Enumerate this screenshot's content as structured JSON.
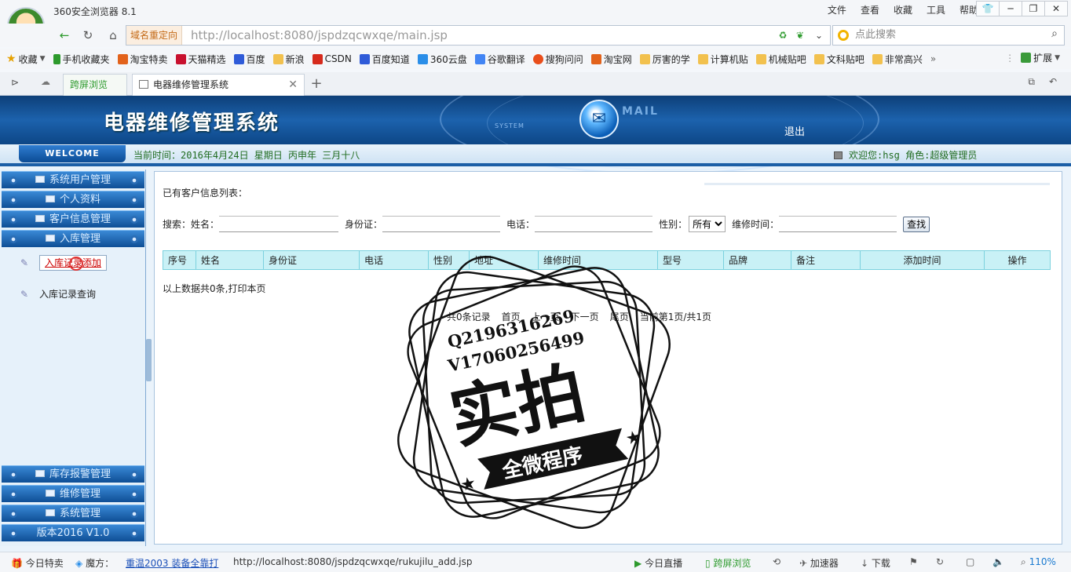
{
  "browser": {
    "app_title": "360安全浏览器 8.1",
    "menu": [
      "文件",
      "查看",
      "收藏",
      "工具",
      "帮助"
    ],
    "redirect_label": "域名重定向",
    "url": "http://localhost:8080/jspdzqcwxqe/main.jsp",
    "search_placeholder": "点此搜索",
    "bookmarks": [
      {
        "label": "收藏",
        "color": "#e6a100"
      },
      {
        "label": "手机收藏夹",
        "color": "#2d9a2d"
      },
      {
        "label": "淘宝特卖",
        "color": "#e2621b"
      },
      {
        "label": "天猫精选",
        "color": "#c8102e"
      },
      {
        "label": "百度",
        "color": "#2f5bd8"
      },
      {
        "label": "新浪",
        "color": "#f2c14e"
      },
      {
        "label": "CSDN",
        "color": "#d62a1c"
      },
      {
        "label": "百度知道",
        "color": "#2f5bd8"
      },
      {
        "label": "360云盘",
        "color": "#2a8ee8"
      },
      {
        "label": "谷歌翻译",
        "color": "#4285f4"
      },
      {
        "label": "搜狗问问",
        "color": "#e94e1b"
      },
      {
        "label": "淘宝网",
        "color": "#e2621b"
      },
      {
        "label": "厉害的学",
        "color": "#f2c14e"
      },
      {
        "label": "计算机贴",
        "color": "#f2c14e"
      },
      {
        "label": "机械贴吧",
        "color": "#f2c14e"
      },
      {
        "label": "文科贴吧",
        "color": "#f2c14e"
      },
      {
        "label": "非常高兴",
        "color": "#f2c14e"
      }
    ],
    "extensions_label": "扩展",
    "tabs": {
      "split_view": "跨屏浏览",
      "active": "电器维修管理系统"
    }
  },
  "header": {
    "system_title": "电器维修管理系统",
    "mail_text": "MAIL",
    "system_text": "SYSTEM",
    "logout": "退出",
    "welcome": "WELCOME",
    "current_time": "当前时间：2016年4月24日 星期日 丙申年 三月十八",
    "user_info": "欢迎您:hsg 角色:超级管理员"
  },
  "sidebar": {
    "menus_top": [
      "系统用户管理",
      "个人资料",
      "客户信息管理",
      "入库管理"
    ],
    "sub_items": [
      "入库记录添加",
      "入库记录查询"
    ],
    "menus_bottom": [
      "库存报警管理",
      "维修管理",
      "系统管理"
    ],
    "version": "版本2016 V1.0"
  },
  "main": {
    "list_title": "已有客户信息列表：",
    "search": {
      "label": "搜索：",
      "name_label": "姓名：",
      "id_label": "身份证：",
      "phone_label": "电话：",
      "gender_label": "性别：",
      "gender_value": "所有",
      "repair_time_label": "维修时间：",
      "button": "查找"
    },
    "columns": [
      "序号",
      "姓名",
      "身份证",
      "电话",
      "性别",
      "地址",
      "维修时间",
      "型号",
      "品牌",
      "备注",
      "添加时间",
      "操作"
    ],
    "summary": "以上数据共0条,打印本页",
    "pager": [
      "共0条记录",
      "首页",
      "上一页",
      "下一页",
      "尾页",
      "当前第1页/共1页"
    ]
  },
  "watermark": {
    "line1": "Q2196316269",
    "line2": "V17060256499",
    "big": "实拍",
    "ribbon": "全微程序"
  },
  "statusbar": {
    "today_deals": "今日特卖",
    "magic": "魔方：",
    "promo": "重温2003 装备全靠打",
    "status_url": "http://localhost:8080/jspdzqcwxqe/rukujilu_add.jsp",
    "live": "今日直播",
    "split_view": "跨屏浏览",
    "accelerator": "加速器",
    "download": "下载",
    "zoom": "110%"
  }
}
